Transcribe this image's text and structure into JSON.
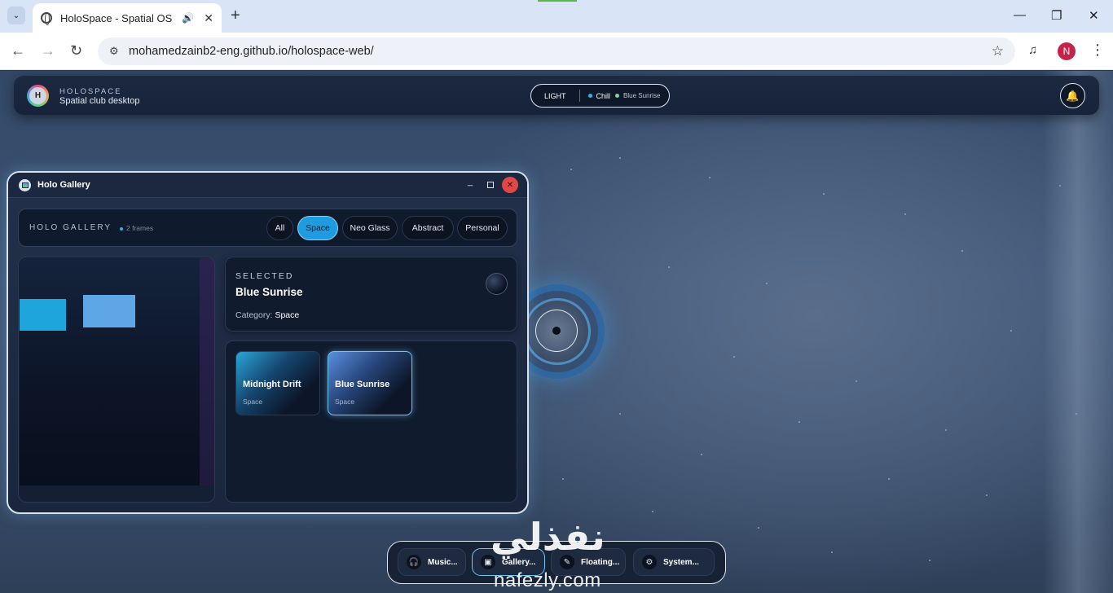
{
  "browser": {
    "tab_title": "HoloSpace - Spatial OS",
    "url": "mohamedzainb2-eng.github.io/holospace-web/",
    "profile_initial": "N"
  },
  "topbar": {
    "logo_letter": "H",
    "brand_kicker": "HOLOSPACE",
    "brand_sub": "Spatial club desktop",
    "mode": "LIGHT",
    "mood": "Chill",
    "mood_color": "#2bb6ea",
    "track": "Blue Sunrise",
    "track_color": "#7fd3a0"
  },
  "gallery_window": {
    "title": "Holo Gallery",
    "kicker": "HOLO GALLERY",
    "count": "2 frames",
    "filters": [
      {
        "label": "All",
        "active": false
      },
      {
        "label": "Space",
        "active": true
      },
      {
        "label": "Neo Glass",
        "active": false
      },
      {
        "label": "Abstract",
        "active": false
      },
      {
        "label": "Personal",
        "active": false
      }
    ],
    "selected": {
      "kicker": "SELECTED",
      "title": "Blue Sunrise",
      "category_label": "Category:",
      "category_value": "Space"
    },
    "frames": [
      {
        "title": "Midnight Drift",
        "category": "Space"
      },
      {
        "title": "Blue Sunrise",
        "category": "Space",
        "selected": true
      }
    ]
  },
  "dock": [
    {
      "label": "Music...",
      "icon": "headphones-icon"
    },
    {
      "label": "Gallery...",
      "icon": "image-icon",
      "active": true
    },
    {
      "label": "Floating...",
      "icon": "note-icon"
    },
    {
      "label": "System...",
      "icon": "gear-icon"
    }
  ],
  "watermark": {
    "arabic": "نفذلي",
    "latin": "nafezly.com"
  }
}
